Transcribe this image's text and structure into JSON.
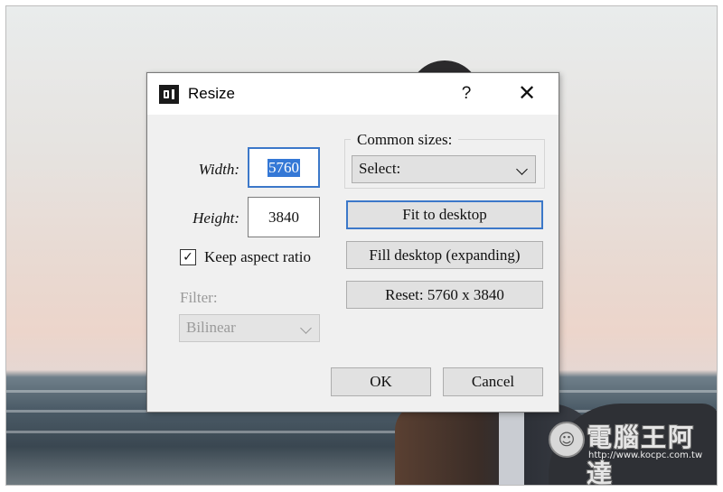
{
  "dialog": {
    "title": "Resize",
    "help_label": "?",
    "close_label": "✕"
  },
  "width": {
    "label": "Width:",
    "value": "5760"
  },
  "height": {
    "label": "Height:",
    "value": "3840"
  },
  "keep_aspect": {
    "label": "Keep aspect ratio",
    "checked": true,
    "mark": "✓"
  },
  "filter": {
    "label": "Filter:",
    "selected": "Bilinear"
  },
  "common_sizes": {
    "label": "Common sizes:",
    "selected": "Select:"
  },
  "buttons": {
    "fit_to_desktop": "Fit to desktop",
    "fill_desktop": "Fill desktop (expanding)",
    "reset": "Reset: 5760 x 3840",
    "ok": "OK",
    "cancel": "Cancel"
  },
  "watermark": {
    "title": "電腦王阿達",
    "url": "http://www.kocpc.com.tw",
    "logo_glyph": "☺"
  },
  "colors": {
    "focus_accent": "#3c78c9",
    "selection": "#3478d6",
    "dialog_bg": "#f0f0f0",
    "button_bg": "#e1e1e1"
  }
}
